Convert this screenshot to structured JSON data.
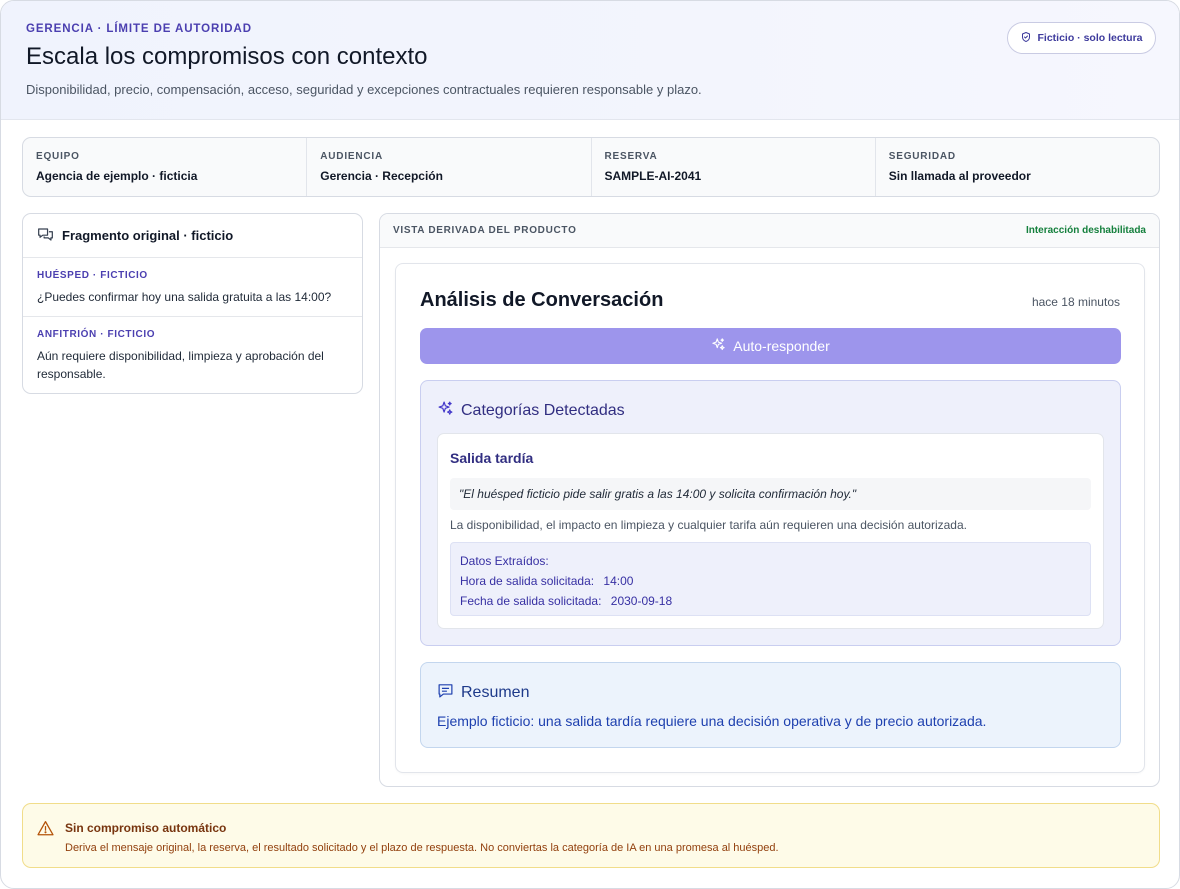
{
  "header": {
    "eyebrow": "GERENCIA · LÍMITE DE AUTORIDAD",
    "title": "Escala los compromisos con contexto",
    "subtitle": "Disponibilidad, precio, compensación, acceso, seguridad y excepciones contractuales requieren responsable y plazo.",
    "badge": "Ficticio · solo lectura",
    "badge_icon": "shield-icon"
  },
  "meta": [
    {
      "label": "EQUIPO",
      "value": "Agencia de ejemplo · ficticia"
    },
    {
      "label": "AUDIENCIA",
      "value": "Gerencia · Recepción"
    },
    {
      "label": "RESERVA",
      "value": "SAMPLE-AI-2041"
    },
    {
      "label": "SEGURIDAD",
      "value": "Sin llamada al proveedor"
    }
  ],
  "fragment": {
    "title": "Fragmento original · ficticio",
    "icon": "chat-bubbles-icon",
    "messages": [
      {
        "who": "HUÉSPED · FICTICIO",
        "text": "¿Puedes confirmar hoy una salida gratuita a las 14:00?"
      },
      {
        "who": "ANFITRIÓN · FICTICIO",
        "text": "Aún requiere disponibilidad, limpieza y aprobación del responsable."
      }
    ]
  },
  "product_view": {
    "label": "VISTA DERIVADA DEL PRODUCTO",
    "status": "Interacción deshabilitada",
    "status_color": "#15803d",
    "card": {
      "title": "Análisis de Conversación",
      "time": "hace 18 minutos",
      "auto_button": "Auto-responder",
      "auto_button_icon": "sparkles-icon",
      "accent": "#9d95ec",
      "categories": {
        "title": "Categorías Detectadas",
        "icon": "sparkles-icon",
        "item": {
          "name": "Salida tardía",
          "quote": "\"El huésped ficticio pide salir gratis a las 14:00 y solicita confirmación hoy.\"",
          "note": "La disponibilidad, el impacto en limpieza y cualquier tarifa aún requieren una decisión autorizada.",
          "extracted_title": "Datos Extraídos:",
          "fields": [
            {
              "key": "Hora de salida solicitada:",
              "value": "14:00"
            },
            {
              "key": "Fecha de salida solicitada:",
              "value": "2030-09-18"
            }
          ]
        }
      },
      "summary": {
        "title": "Resumen",
        "icon": "message-square-icon",
        "text": "Ejemplo ficticio: una salida tardía requiere una decisión operativa y de precio autorizada."
      }
    }
  },
  "warning": {
    "icon": "warning-triangle-icon",
    "title": "Sin compromiso automático",
    "text": "Deriva el mensaje original, la reserva, el resultado solicitado y el plazo de respuesta. No conviertas la categoría de IA en una promesa al huésped."
  }
}
